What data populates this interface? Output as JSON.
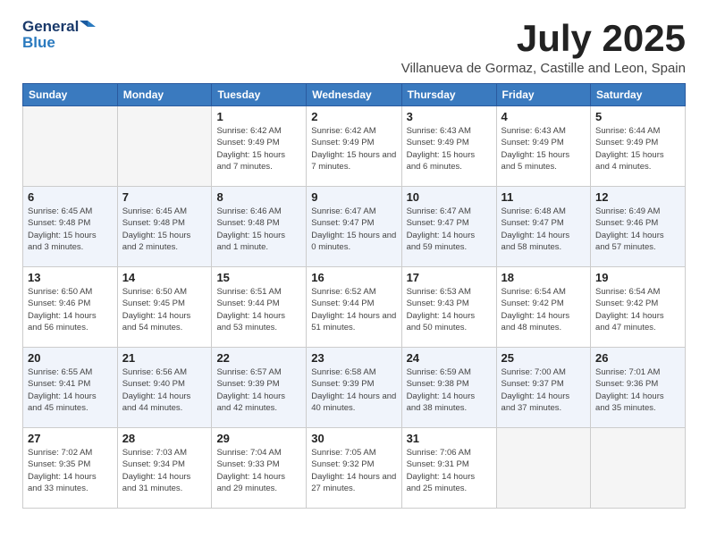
{
  "header": {
    "logo_line1": "General",
    "logo_line2": "Blue",
    "title": "July 2025",
    "location": "Villanueva de Gormaz, Castille and Leon, Spain"
  },
  "weekdays": [
    "Sunday",
    "Monday",
    "Tuesday",
    "Wednesday",
    "Thursday",
    "Friday",
    "Saturday"
  ],
  "weeks": [
    [
      {
        "num": "",
        "info": ""
      },
      {
        "num": "",
        "info": ""
      },
      {
        "num": "1",
        "info": "Sunrise: 6:42 AM\nSunset: 9:49 PM\nDaylight: 15 hours and 7 minutes."
      },
      {
        "num": "2",
        "info": "Sunrise: 6:42 AM\nSunset: 9:49 PM\nDaylight: 15 hours and 7 minutes."
      },
      {
        "num": "3",
        "info": "Sunrise: 6:43 AM\nSunset: 9:49 PM\nDaylight: 15 hours and 6 minutes."
      },
      {
        "num": "4",
        "info": "Sunrise: 6:43 AM\nSunset: 9:49 PM\nDaylight: 15 hours and 5 minutes."
      },
      {
        "num": "5",
        "info": "Sunrise: 6:44 AM\nSunset: 9:49 PM\nDaylight: 15 hours and 4 minutes."
      }
    ],
    [
      {
        "num": "6",
        "info": "Sunrise: 6:45 AM\nSunset: 9:48 PM\nDaylight: 15 hours and 3 minutes."
      },
      {
        "num": "7",
        "info": "Sunrise: 6:45 AM\nSunset: 9:48 PM\nDaylight: 15 hours and 2 minutes."
      },
      {
        "num": "8",
        "info": "Sunrise: 6:46 AM\nSunset: 9:48 PM\nDaylight: 15 hours and 1 minute."
      },
      {
        "num": "9",
        "info": "Sunrise: 6:47 AM\nSunset: 9:47 PM\nDaylight: 15 hours and 0 minutes."
      },
      {
        "num": "10",
        "info": "Sunrise: 6:47 AM\nSunset: 9:47 PM\nDaylight: 14 hours and 59 minutes."
      },
      {
        "num": "11",
        "info": "Sunrise: 6:48 AM\nSunset: 9:47 PM\nDaylight: 14 hours and 58 minutes."
      },
      {
        "num": "12",
        "info": "Sunrise: 6:49 AM\nSunset: 9:46 PM\nDaylight: 14 hours and 57 minutes."
      }
    ],
    [
      {
        "num": "13",
        "info": "Sunrise: 6:50 AM\nSunset: 9:46 PM\nDaylight: 14 hours and 56 minutes."
      },
      {
        "num": "14",
        "info": "Sunrise: 6:50 AM\nSunset: 9:45 PM\nDaylight: 14 hours and 54 minutes."
      },
      {
        "num": "15",
        "info": "Sunrise: 6:51 AM\nSunset: 9:44 PM\nDaylight: 14 hours and 53 minutes."
      },
      {
        "num": "16",
        "info": "Sunrise: 6:52 AM\nSunset: 9:44 PM\nDaylight: 14 hours and 51 minutes."
      },
      {
        "num": "17",
        "info": "Sunrise: 6:53 AM\nSunset: 9:43 PM\nDaylight: 14 hours and 50 minutes."
      },
      {
        "num": "18",
        "info": "Sunrise: 6:54 AM\nSunset: 9:42 PM\nDaylight: 14 hours and 48 minutes."
      },
      {
        "num": "19",
        "info": "Sunrise: 6:54 AM\nSunset: 9:42 PM\nDaylight: 14 hours and 47 minutes."
      }
    ],
    [
      {
        "num": "20",
        "info": "Sunrise: 6:55 AM\nSunset: 9:41 PM\nDaylight: 14 hours and 45 minutes."
      },
      {
        "num": "21",
        "info": "Sunrise: 6:56 AM\nSunset: 9:40 PM\nDaylight: 14 hours and 44 minutes."
      },
      {
        "num": "22",
        "info": "Sunrise: 6:57 AM\nSunset: 9:39 PM\nDaylight: 14 hours and 42 minutes."
      },
      {
        "num": "23",
        "info": "Sunrise: 6:58 AM\nSunset: 9:39 PM\nDaylight: 14 hours and 40 minutes."
      },
      {
        "num": "24",
        "info": "Sunrise: 6:59 AM\nSunset: 9:38 PM\nDaylight: 14 hours and 38 minutes."
      },
      {
        "num": "25",
        "info": "Sunrise: 7:00 AM\nSunset: 9:37 PM\nDaylight: 14 hours and 37 minutes."
      },
      {
        "num": "26",
        "info": "Sunrise: 7:01 AM\nSunset: 9:36 PM\nDaylight: 14 hours and 35 minutes."
      }
    ],
    [
      {
        "num": "27",
        "info": "Sunrise: 7:02 AM\nSunset: 9:35 PM\nDaylight: 14 hours and 33 minutes."
      },
      {
        "num": "28",
        "info": "Sunrise: 7:03 AM\nSunset: 9:34 PM\nDaylight: 14 hours and 31 minutes."
      },
      {
        "num": "29",
        "info": "Sunrise: 7:04 AM\nSunset: 9:33 PM\nDaylight: 14 hours and 29 minutes."
      },
      {
        "num": "30",
        "info": "Sunrise: 7:05 AM\nSunset: 9:32 PM\nDaylight: 14 hours and 27 minutes."
      },
      {
        "num": "31",
        "info": "Sunrise: 7:06 AM\nSunset: 9:31 PM\nDaylight: 14 hours and 25 minutes."
      },
      {
        "num": "",
        "info": ""
      },
      {
        "num": "",
        "info": ""
      }
    ]
  ]
}
